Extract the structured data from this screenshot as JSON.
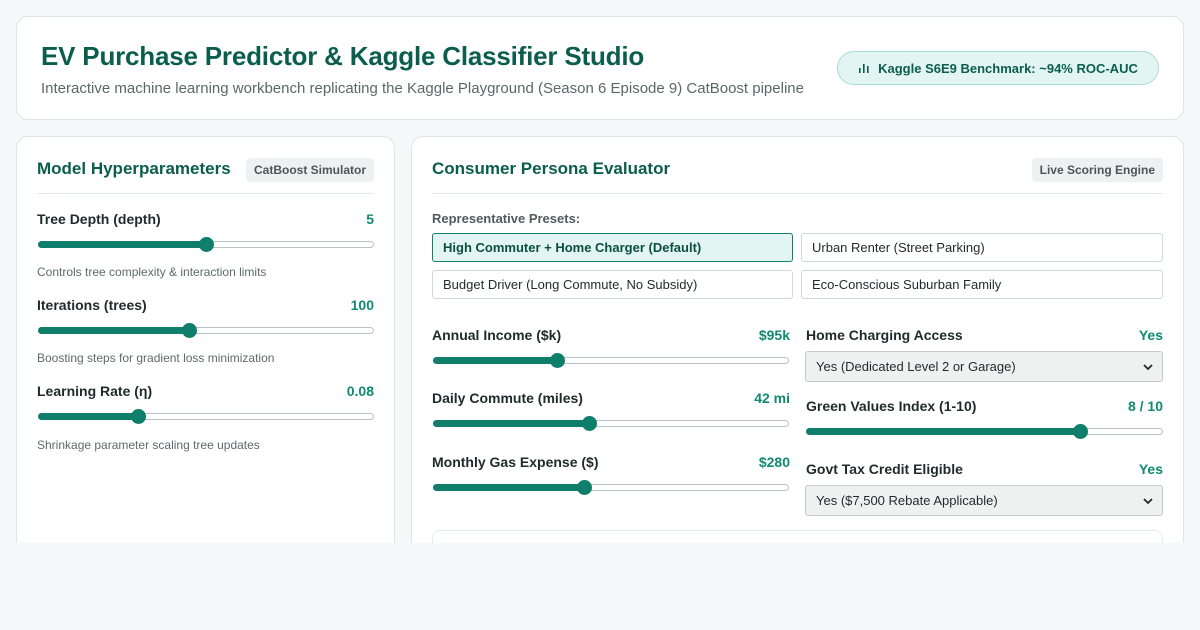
{
  "header": {
    "title": "EV Purchase Predictor & Kaggle Classifier Studio",
    "subtitle": "Interactive machine learning workbench replicating the Kaggle Playground (Season 6 Episode 9) CatBoost pipeline",
    "benchmark": "Kaggle S6E9 Benchmark: ~94% ROC-AUC",
    "benchmark_icon": "bar-chart-icon"
  },
  "hyperparams": {
    "title": "Model Hyperparameters",
    "tag": "CatBoost Simulator",
    "items": [
      {
        "label": "Tree Depth (depth)",
        "value": "5",
        "level": 0.5,
        "help": "Controls tree complexity & interaction limits"
      },
      {
        "label": "Iterations (trees)",
        "value": "100",
        "level": 0.45,
        "help": "Boosting steps for gradient loss minimization"
      },
      {
        "label": "Learning Rate (η)",
        "value": "0.08",
        "level": 0.3,
        "help": "Shrinkage parameter scaling tree updates"
      }
    ]
  },
  "persona": {
    "title": "Consumer Persona Evaluator",
    "tag": "Live Scoring Engine",
    "presets_label": "Representative Presets:",
    "presets": [
      {
        "label": "High Commuter + Home Charger (Default)",
        "active": true
      },
      {
        "label": "Urban Renter (Street Parking)",
        "active": false
      },
      {
        "label": "Budget Driver (Long Commute, No Subsidy)",
        "active": false
      },
      {
        "label": "Eco-Conscious Suburban Family",
        "active": false
      }
    ],
    "sliders": [
      {
        "label": "Annual Income ($k)",
        "value": "$95k",
        "level": 0.35
      },
      {
        "label": "Daily Commute (miles)",
        "value": "42 mi",
        "level": 0.44
      },
      {
        "label": "Monthly Gas Expense ($)",
        "value": "$280",
        "level": 0.425
      }
    ],
    "charging": {
      "label": "Home Charging Access",
      "value": "Yes",
      "selected": "Yes (Dedicated Level 2 or Garage)"
    },
    "green": {
      "label": "Green Values Index (1-10)",
      "value": "8 / 10",
      "level": 0.77
    },
    "tax": {
      "label": "Govt Tax Credit Eligible",
      "value": "Yes",
      "selected": "Yes ($7,500 Rebate Applicable)"
    }
  },
  "colors": {
    "accent": "#0f7f6b",
    "title": "#0b5e4d",
    "value": "#0f8a73"
  }
}
